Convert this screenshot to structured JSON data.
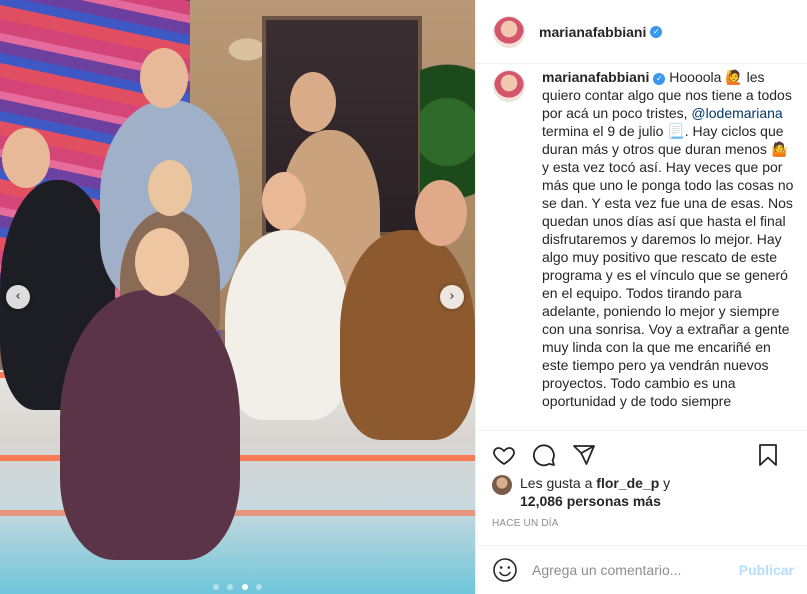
{
  "post": {
    "username": "marianafabbiani",
    "verified_glyph": "✓",
    "caption": {
      "username": "marianafabbiani",
      "text_1": " Hoooola 🙋 les quiero contar algo que nos tiene a todos por acá un poco tristes, ",
      "mention": "@lodemariana",
      "text_2": " termina el 9 de julio 📃. Hay ciclos que duran más y otros que duran menos 🤷 y esta vez tocó así. Hay veces que por más que uno le ponga todo las cosas no se dan. Y esta vez fue una de esas. Nos quedan unos días así que hasta el final disfrutaremos y daremos lo mejor. Hay algo muy positivo que rescato de este programa y es el vínculo que se generó en el equipo. Todos tirando para adelante, poniendo lo mejor y siempre con una sonrisa. Voy a extrañar a gente muy linda con la que me encariñé en este tiempo pero ya vendrán nuevos proyectos. Todo cambio es una oportunidad y de todo siempre"
    },
    "likes": {
      "prefix": "Les gusta a ",
      "user": "flor_de_p",
      "suffix": " y",
      "count_text": "12,086 personas más"
    },
    "time_ago": "HACE UN DÍA",
    "comment": {
      "placeholder": "Agrega un comentario...",
      "post_label": "Publicar"
    },
    "carousel": {
      "prev_glyph": "‹",
      "next_glyph": "›",
      "slides": 4,
      "active_index": 2
    }
  },
  "icons": [
    "heart-icon",
    "comment-icon",
    "share-icon",
    "bookmark-icon",
    "emoji-icon",
    "verified-icon"
  ],
  "colors": {
    "link": "#00376b",
    "verified": "#3897f0",
    "muted": "#8e8e8e",
    "post_disabled": "#b2dffc"
  }
}
